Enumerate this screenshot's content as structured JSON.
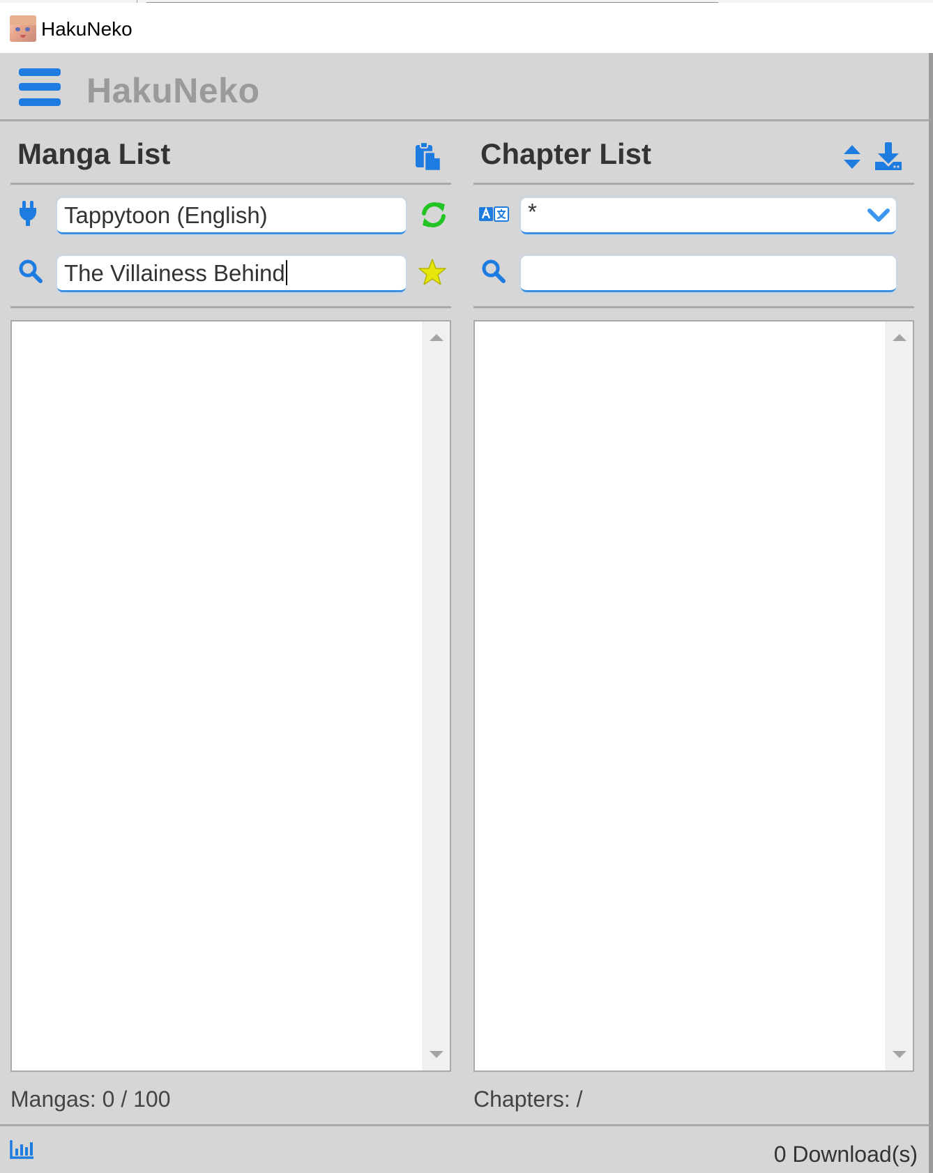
{
  "window": {
    "title": "HakuNeko"
  },
  "header": {
    "brand": "HakuNeko"
  },
  "manga_panel": {
    "title": "Manga List",
    "connector_value": "Tappytoon (English)",
    "search_value": "The Villainess Behind",
    "count_label": "Mangas: 0 / 100"
  },
  "chapter_panel": {
    "title": "Chapter List",
    "language_value": "*",
    "search_value": "",
    "count_label": "Chapters: /"
  },
  "footer": {
    "downloads_label": "0 Download(s)"
  },
  "colors": {
    "accent": "#1e7be0",
    "refresh": "#22c322",
    "star": "#e6e60a",
    "brand_text": "#9a9a9a",
    "panel_bg": "#d6d6d6"
  },
  "icons": {
    "menu": "hamburger-menu-icon",
    "paste": "paste-icon",
    "plug": "plug-icon",
    "refresh": "refresh-icon",
    "search": "search-icon",
    "favorite": "star-icon",
    "sort": "sort-icon",
    "download": "download-icon",
    "language": "translate-icon",
    "dropdown": "chevron-down-icon",
    "stats": "stats-chart-icon"
  }
}
